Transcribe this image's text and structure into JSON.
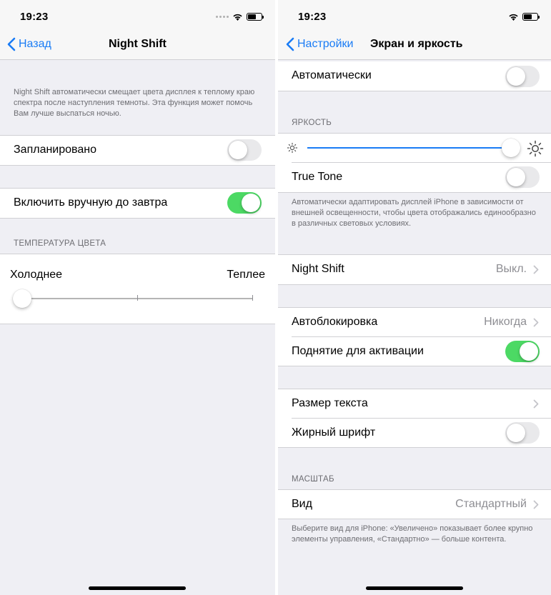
{
  "colors": {
    "accent": "#1a7cf5",
    "toggle_on": "#4cd964",
    "background": "#efeff4"
  },
  "left": {
    "status": {
      "time": "19:23"
    },
    "nav": {
      "back_label": "Назад",
      "title": "Night Shift"
    },
    "description": "Night Shift автоматически смещает цвета дисплея к теплому краю спектра после наступления темноты. Эта функция может помочь Вам лучше выспаться ночью.",
    "scheduled": {
      "label": "Запланировано",
      "on": false
    },
    "manual": {
      "label": "Включить вручную до завтра",
      "on": true
    },
    "temperature": {
      "header": "ТЕМПЕРАТУРА ЦВЕТА",
      "min_label": "Холоднее",
      "max_label": "Теплее",
      "value": 0
    }
  },
  "right": {
    "status": {
      "time": "19:23"
    },
    "nav": {
      "back_label": "Настройки",
      "title": "Экран и яркость"
    },
    "auto": {
      "label": "Автоматически",
      "on": false
    },
    "brightness": {
      "header": "ЯРКОСТЬ",
      "value": 1.0
    },
    "true_tone": {
      "label": "True Tone",
      "on": false
    },
    "true_tone_footer": "Автоматически адаптировать дисплей iPhone в зависимости от внешней освещенности, чтобы цвета отображались единообразно в различных световых условиях.",
    "night_shift": {
      "label": "Night Shift",
      "value": "Выкл."
    },
    "autolock": {
      "label": "Автоблокировка",
      "value": "Никогда"
    },
    "raise_to_wake": {
      "label": "Поднятие для активации",
      "on": true
    },
    "text_size": {
      "label": "Размер текста"
    },
    "bold_text": {
      "label": "Жирный шрифт",
      "on": false
    },
    "zoom": {
      "header": "МАСШТАБ",
      "label": "Вид",
      "value": "Стандартный"
    },
    "zoom_footer": "Выберите вид для iPhone: «Увеличено» показывает более крупно элементы управления, «Стандартно» — больше контента."
  }
}
